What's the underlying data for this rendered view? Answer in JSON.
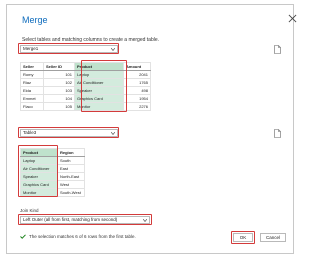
{
  "dialog": {
    "title": "Merge",
    "subtitle": "Select tables and matching columns to create a merged table."
  },
  "table1": {
    "selected": "Merge1",
    "columns": [
      "Seller",
      "Seller ID",
      "Product",
      "Amount"
    ],
    "rows": [
      [
        "Romy",
        "101",
        "Laptop",
        "2041"
      ],
      [
        "Riaz",
        "102",
        "Air Conditioner",
        "1765"
      ],
      [
        "Elda",
        "103",
        "Speaker",
        "498"
      ],
      [
        "Emmet",
        "104",
        "Graphics Card",
        "1954"
      ],
      [
        "Flaco",
        "105",
        "Monitor",
        "2276"
      ]
    ]
  },
  "table2": {
    "selected": "Table3",
    "columns": [
      "Product",
      "Region"
    ],
    "rows": [
      [
        "Laptop",
        "South"
      ],
      [
        "Air Conditioner",
        "East"
      ],
      [
        "Speaker",
        "North-East"
      ],
      [
        "Graphics Card",
        "West"
      ],
      [
        "Monitor",
        "South-West"
      ]
    ]
  },
  "join": {
    "label": "Join Kind",
    "selected": "Left Outer (all from first, matching from second)"
  },
  "status": {
    "text": "The selection matches 6 of 6 rows from the first table."
  },
  "buttons": {
    "ok": "OK",
    "cancel": "Cancel"
  },
  "colors": {
    "title": "#0f6cbd",
    "highlight": "#d3ebdd",
    "annotation": "#d33b3b",
    "success": "#107c10"
  }
}
